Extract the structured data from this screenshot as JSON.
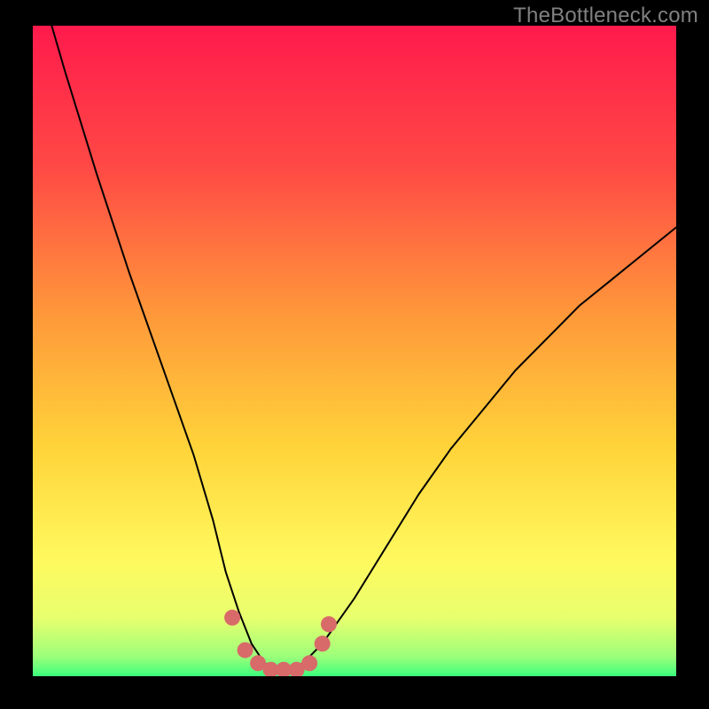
{
  "watermark": "TheBottleneck.com",
  "colors": {
    "background": "#000000",
    "gradient_top": "#ff1a4c",
    "gradient_mid1": "#ff8a3b",
    "gradient_mid2": "#ffe63b",
    "gradient_low": "#f4ff6b",
    "gradient_bottom": "#3cff7d",
    "curve": "#000000",
    "marker": "#d86a6a",
    "watermark": "#808080"
  },
  "chart_data": {
    "type": "line",
    "title": "",
    "xlabel": "",
    "ylabel": "",
    "xlim": [
      0,
      100
    ],
    "ylim": [
      0,
      100
    ],
    "series": [
      {
        "name": "bottleneck-curve",
        "x": [
          0,
          5,
          10,
          15,
          20,
          25,
          28,
          30,
          32,
          34,
          36,
          38,
          40,
          42,
          45,
          50,
          55,
          60,
          65,
          70,
          75,
          80,
          85,
          90,
          95,
          100
        ],
        "values": [
          110,
          93,
          77,
          62,
          48,
          34,
          24,
          16,
          10,
          5,
          2,
          1,
          1,
          2,
          5,
          12,
          20,
          28,
          35,
          41,
          47,
          52,
          57,
          61,
          65,
          69
        ]
      }
    ],
    "markers": {
      "name": "optimal-region-dots",
      "x": [
        31,
        33,
        35,
        37,
        39,
        41,
        43,
        45,
        46
      ],
      "values": [
        9,
        4,
        2,
        1,
        1,
        1,
        2,
        5,
        8
      ]
    }
  }
}
